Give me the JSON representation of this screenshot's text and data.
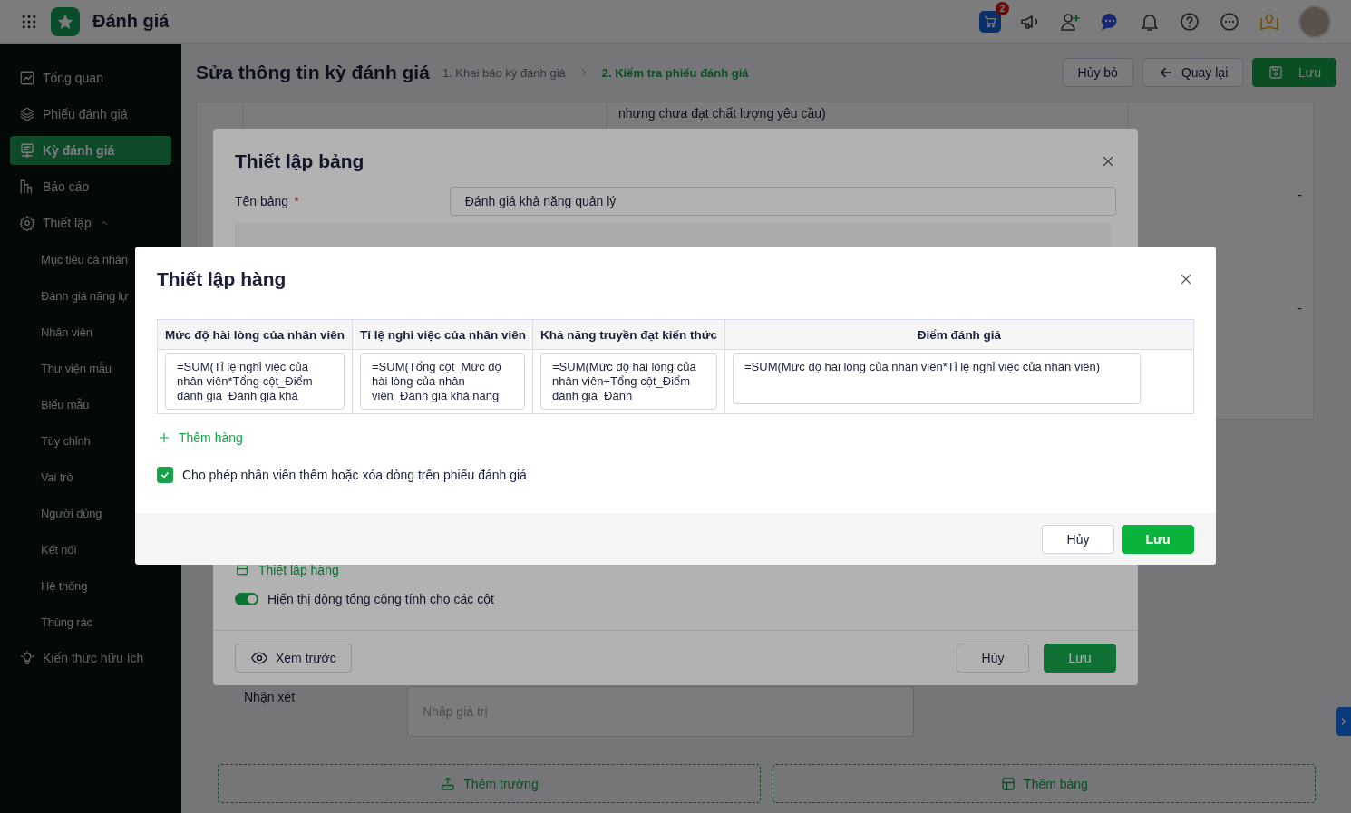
{
  "app": {
    "title": "Đánh giá",
    "cart_badge": "2"
  },
  "sidebar": {
    "items": [
      {
        "label": "Tổng quan",
        "selected": false
      },
      {
        "label": "Phiếu đánh giá",
        "selected": false
      },
      {
        "label": "Kỳ đánh giá",
        "selected": true
      },
      {
        "label": "Báo cáo",
        "selected": false
      },
      {
        "label": "Thiết lập",
        "selected": false,
        "expanded": true,
        "children": [
          {
            "label": "Mục tiêu cá nhân",
            "selected": false
          },
          {
            "label": "Đánh giá năng lự",
            "selected": false
          },
          {
            "label": "Nhân viên",
            "selected": false
          },
          {
            "label": "Thư viện mẫu",
            "selected": false
          },
          {
            "label": "Biểu mẫu",
            "selected": false
          },
          {
            "label": "Tùy chỉnh",
            "selected": false
          },
          {
            "label": "Vai trò",
            "selected": false
          },
          {
            "label": "Người dùng",
            "selected": false
          },
          {
            "label": "Kết nối",
            "selected": false
          },
          {
            "label": "Hệ thống",
            "selected": false
          },
          {
            "label": "Thùng rác",
            "selected": false
          }
        ]
      },
      {
        "label": "Kiến thức hữu ích",
        "selected": false
      }
    ]
  },
  "page": {
    "title": "Sửa thông tin kỳ đánh giá",
    "steps": [
      {
        "label": "1. Khai báo kỳ đánh giá",
        "selected": false
      },
      {
        "label": "2. Kiểm tra phiếu đánh giá",
        "selected": true
      }
    ],
    "buttons": [
      "Hủy bỏ",
      "Quay lại",
      "Lưu"
    ]
  },
  "form": {
    "criteria_text": "nhưng chưa đạt chất lượng yêu cầu)",
    "dashes": [
      "-",
      "-"
    ],
    "comment_label": "Nhận xét",
    "comment_placeholder": "Nhập giá trị",
    "add_buttons": [
      "Thêm trường",
      "Thêm bảng"
    ]
  },
  "table_modal": {
    "title": "Thiết lập bảng",
    "name_label": "Tên bảng",
    "required_mark": "*",
    "name_value": "Đánh giá khả năng quản lý",
    "row_setup_link": "Thiết lập hàng",
    "toggle": {
      "label": "Hiển thị dòng tổng cộng tính cho các cột",
      "on": true
    },
    "preview_button": "Xem trước",
    "buttons": [
      "Hủy",
      "Lưu"
    ]
  },
  "row_modal": {
    "title": "Thiết lập hàng",
    "columns": [
      "Mức độ hài lòng của nhân viên",
      "Tỉ lệ nghỉ việc của nhân viên",
      "Khả năng truyền đạt kiến thức",
      "Điểm đánh giá"
    ],
    "rows": [
      [
        "=SUM(Tỉ lệ nghỉ việc của nhân viên*Tổng cột_Điểm đánh giá_Đánh giá khả",
        "=SUM(Tổng cột_Mức độ hài lòng của nhân viên_Đánh giá khả năng",
        "=SUM(Mức độ hài lòng của nhân viên+Tổng cột_Điểm đánh giá_Đánh",
        "=SUM(Mức độ hài lòng của nhân viên*Tỉ lệ nghỉ việc của nhân viên)"
      ]
    ],
    "add_row": "Thêm hàng",
    "allow": {
      "label": "Cho phép nhân viên thêm hoặc xóa dòng trên phiếu đánh giá",
      "checked": true
    },
    "buttons": [
      "Hủy",
      "Lưu"
    ]
  }
}
